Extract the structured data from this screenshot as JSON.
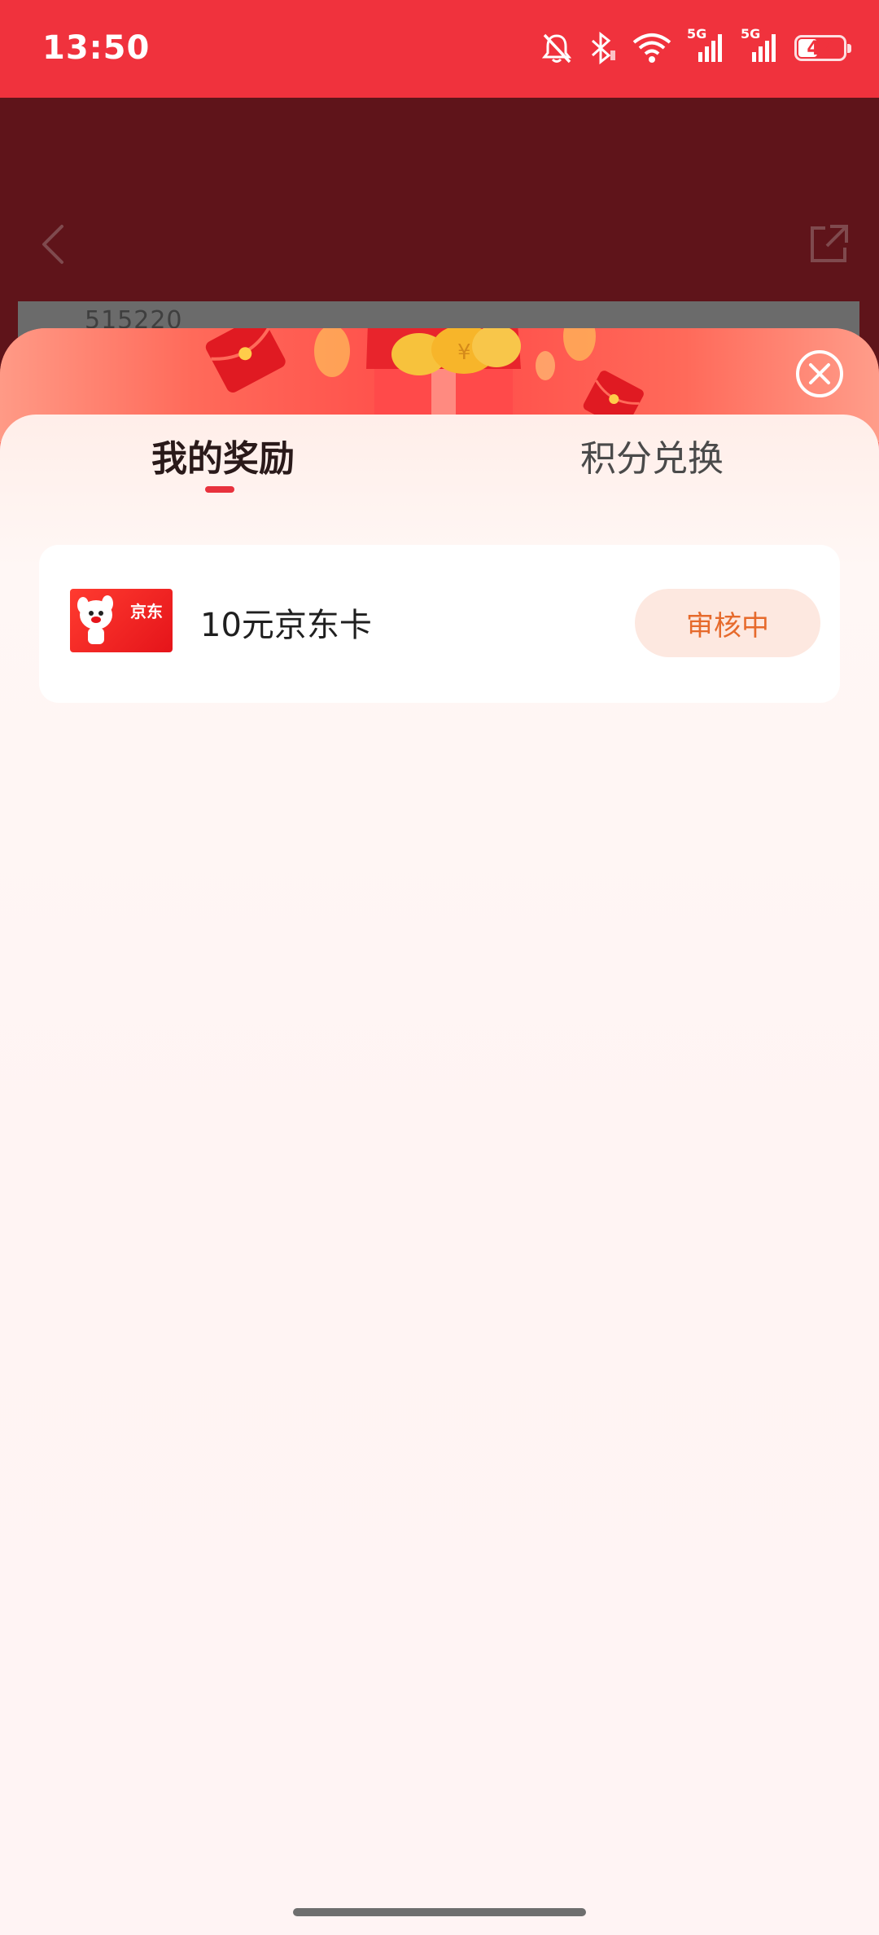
{
  "status_bar": {
    "time": "13:50",
    "network_1": "5G",
    "network_2": "5G",
    "battery": "42",
    "battery_level": 0.42
  },
  "background_page": {
    "partial_text": "515220"
  },
  "popup": {
    "tabs": [
      {
        "label": "我的奖励",
        "active": true
      },
      {
        "label": "积分兑换",
        "active": false
      }
    ],
    "rewards": [
      {
        "thumbnail_brand": "京东",
        "name": "10元京东卡",
        "status": "审核中"
      }
    ]
  },
  "colors": {
    "status_bar": "#f0323d",
    "accent": "#e8323d",
    "status_button_text": "#e66a2c",
    "status_button_bg": "#fde8e0"
  }
}
